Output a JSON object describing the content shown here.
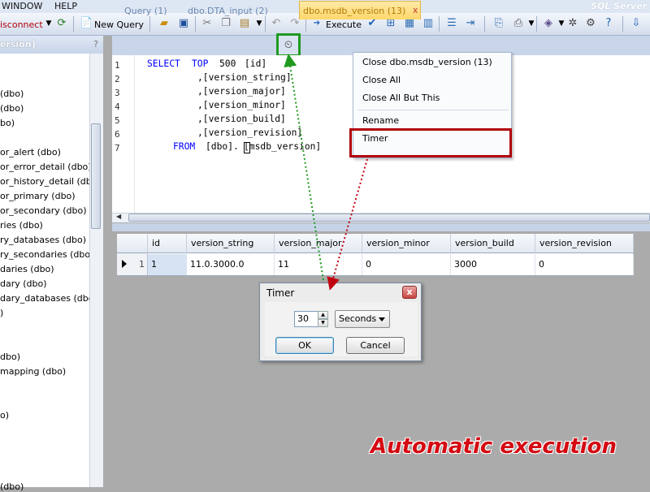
{
  "menubar": {
    "items": [
      "WINDOW",
      "HELP"
    ],
    "brand": "SQL Server"
  },
  "toolbar": {
    "disconnect": "isconnect",
    "new_query": "New Query",
    "execute": "Execute"
  },
  "explorer": {
    "title": "ersion]",
    "help": "?",
    "items": [
      "(dbo)",
      "(dbo)",
      "bo)",
      "or_alert (dbo)",
      "or_error_detail (dbo)",
      "or_history_detail (dbo)",
      "or_primary (dbo)",
      "or_secondary (dbo)",
      "ries (dbo)",
      "ry_databases (dbo)",
      "ry_secondaries (dbo)",
      "daries (dbo)",
      "dary (dbo)",
      "dary_databases (dbo)",
      ")",
      "dbo)",
      "mapping (dbo)",
      "o)",
      "(dbo)"
    ]
  },
  "tabs": [
    "Query (1)",
    "dbo.DTA_input (2)",
    "dbo.msdb_version (13)"
  ],
  "tab_close": "x",
  "editor": {
    "line_numbers": [
      "1",
      "2",
      "3",
      "4",
      "5",
      "6",
      "7"
    ],
    "line1": {
      "kw1": "SELECT",
      "kw2": "TOP",
      "num": "500",
      "rest": "[id]"
    },
    "line2": ",[version_string]",
    "line3": ",[version_major]",
    "line4": ",[version_minor]",
    "line5": ",[version_build]",
    "line6": ",[version_revision]",
    "line7": {
      "kw": "FROM",
      "schema": "[dbo].",
      "table": "[msdb_version]"
    }
  },
  "grid": {
    "columns": [
      "id",
      "version_string",
      "version_major",
      "version_minor",
      "version_build",
      "version_revision"
    ],
    "row_number": "1",
    "row": [
      "1",
      "11.0.3000.0",
      "11",
      "0",
      "3000",
      "0"
    ]
  },
  "context_menu": {
    "items": [
      "Close dbo.msdb_version (13)",
      "Close All",
      "Close All But This",
      "Rename",
      "Timer"
    ]
  },
  "dialog": {
    "title": "Timer",
    "close": "x",
    "interval": "30",
    "unit": "Seconds",
    "ok": "OK",
    "cancel": "Cancel"
  },
  "caption": "Automatic execution",
  "colors": {
    "highlight_red": "#b0000a",
    "highlight_green": "#1f9a1f",
    "caption": "#d40a12",
    "keyword": "#0000ff"
  }
}
